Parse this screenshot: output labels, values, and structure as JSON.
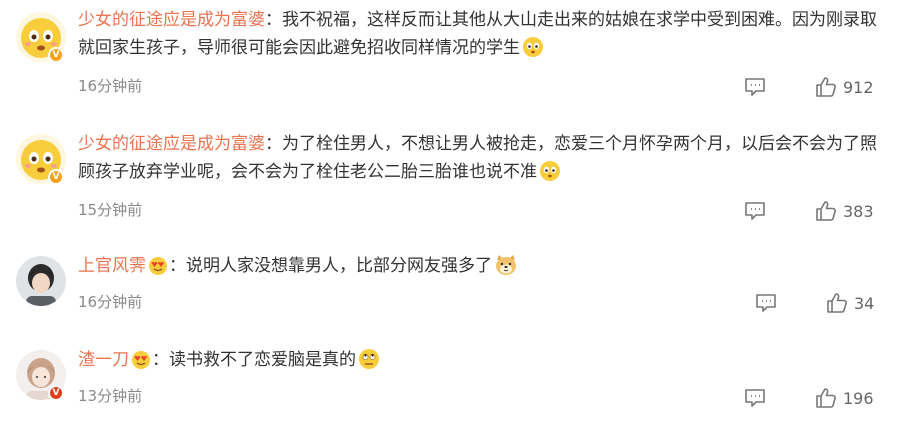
{
  "comments": [
    {
      "username": "少女的征途应是成为富婆",
      "separator": "：",
      "text": "我不祝福，这样反而让其他从大山走出来的姑娘在求学中受到困难。因为刚录取就回家生孩子，导师很可能会因此避免招收同样情况的学生",
      "emoji": "eyes-wide-emoji",
      "time": "16分钟前",
      "likes": "912",
      "badge": "V"
    },
    {
      "username": "少女的征途应是成为富婆",
      "separator": "：",
      "text": "为了栓住男人，不想让男人被抢走，恋爱三个月怀孕两个月，以后会不会为了照顾孩子放弃学业呢，会不会为了栓住老公二胎三胎谁也说不准",
      "emoji": "eyes-wide-emoji",
      "time": "15分钟前",
      "likes": "383",
      "badge": "V"
    },
    {
      "username": "上官风霁",
      "separator": "：",
      "text": "说明人家没想靠男人，比部分网友强多了",
      "emoji": "doge-emoji",
      "time": "16分钟前",
      "likes": "34",
      "badge": ""
    },
    {
      "username": "渣一刀",
      "separator": "：",
      "text": "读书救不了恋爱脑是真的",
      "emoji": "eye-roll-emoji",
      "time": "13分钟前",
      "likes": "196",
      "badge": "V"
    }
  ],
  "colors": {
    "username": "#eb7350",
    "text": "#333333",
    "meta": "#8a8a8a"
  },
  "icons": {
    "reply": "comment-icon",
    "like": "thumbs-up-icon",
    "fan_badge": "heart-eyes-badge-icon"
  }
}
